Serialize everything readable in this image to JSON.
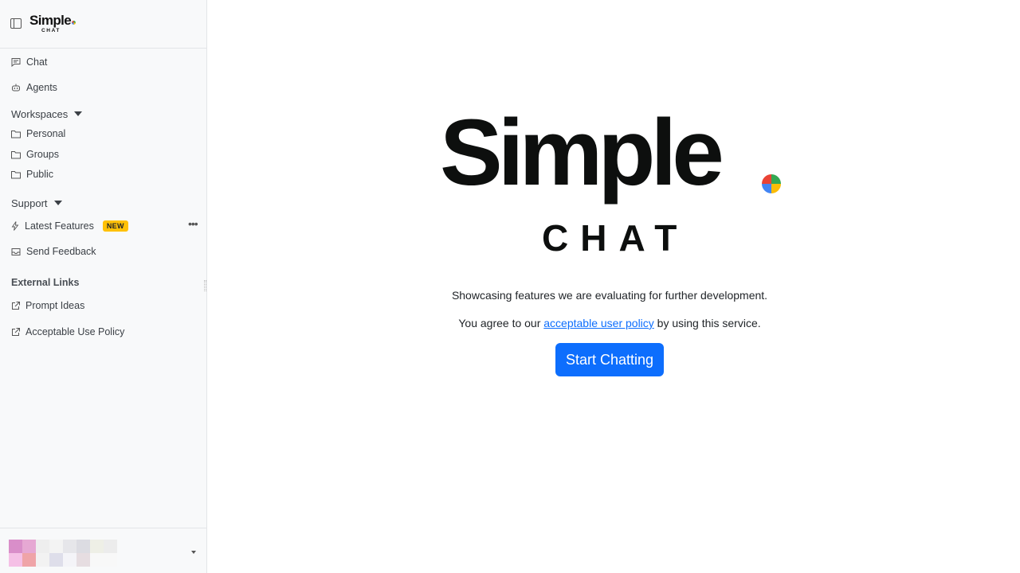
{
  "sidebar": {
    "logo": {
      "word": "Simple",
      "sub": "CHAT"
    },
    "nav": {
      "chat": "Chat",
      "agents": "Agents"
    },
    "workspaces": {
      "title": "Workspaces",
      "items": [
        "Personal",
        "Groups",
        "Public"
      ]
    },
    "support": {
      "title": "Support",
      "latest_features": "Latest Features",
      "new_badge": "NEW",
      "send_feedback": "Send Feedback"
    },
    "external": {
      "title": "External Links",
      "items": [
        "Prompt Ideas",
        "Acceptable Use Policy"
      ]
    },
    "footer": {
      "avatar_colors": [
        "#d98ec9",
        "#e6a8d3",
        "#eeeeee",
        "#f3f3f3",
        "#e6e6ea",
        "#dcdce2",
        "#eeefe6",
        "#ececec",
        "#f5c0e6",
        "#efa4a8",
        "#f2f2f2",
        "#dedeea",
        "#f4f4f8",
        "#e6dde1",
        "#f8f8f8",
        "#f8f8f8"
      ]
    }
  },
  "main": {
    "hero": {
      "word": "Simple",
      "sub": "CHAT"
    },
    "tagline": "Showcasing features we are evaluating for further development.",
    "agree_prefix": "You agree to our ",
    "agree_link": "acceptable user policy",
    "agree_suffix": " by using this service.",
    "start_button": "Start Chatting"
  },
  "colors": {
    "accent": "#0d6efd",
    "badge": "#ffc107",
    "sidebar_bg": "#f8f9fa"
  }
}
